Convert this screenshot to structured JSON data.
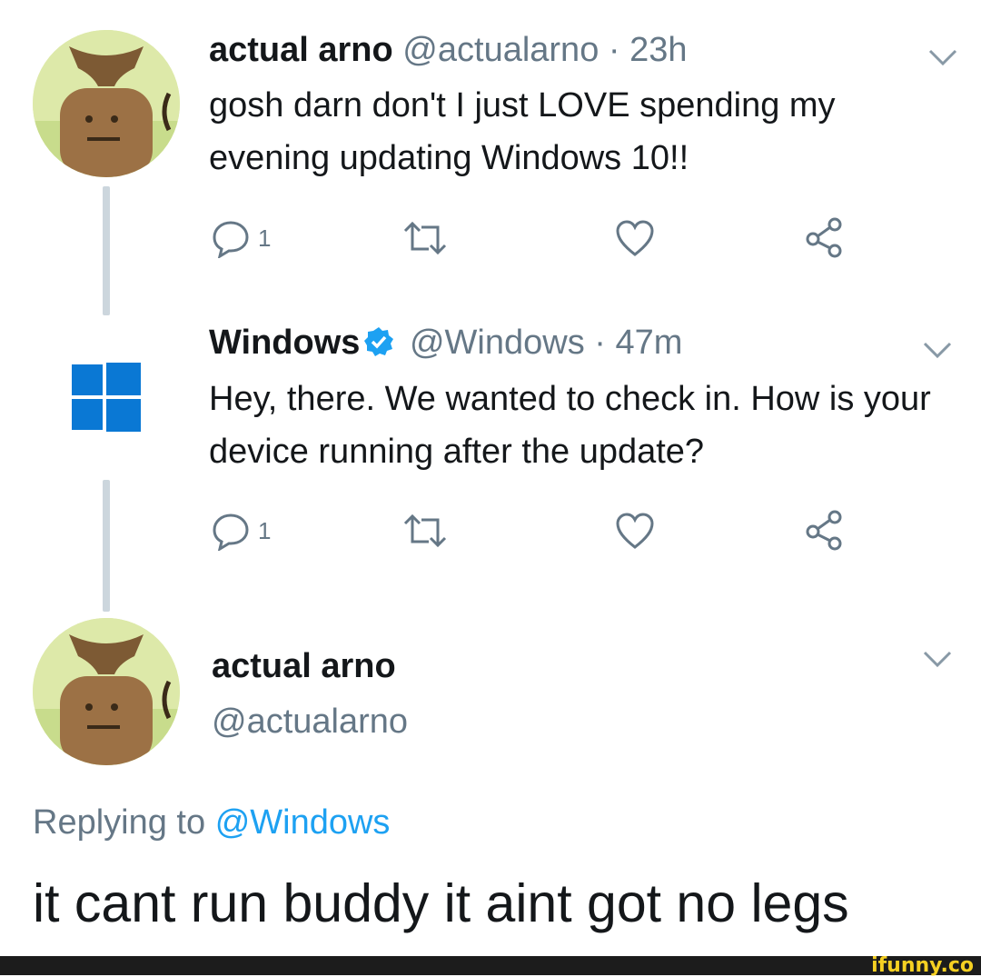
{
  "tweet1": {
    "name": "actual arno",
    "handle": "@actualarno",
    "separator": "·",
    "time": "23h",
    "text": "gosh darn don't I just LOVE spending my evening updating Windows 10!!",
    "reply_count": "1"
  },
  "tweet2": {
    "name": "Windows",
    "handle": "@Windows",
    "separator": "·",
    "time": "47m",
    "text": "Hey, there. We wanted to check in. How is your device running after the update?",
    "reply_count": "1"
  },
  "reply": {
    "name": "actual arno",
    "handle": "@actualarno",
    "replying_prefix": "Replying to",
    "replying_mention": "@Windows",
    "text": "it cant run buddy it aint got no legs"
  },
  "watermark": "ifunny.co",
  "colors": {
    "accent": "#1da1f2",
    "muted": "#657786",
    "thread_line": "#ccd6dd",
    "windows_blue": "#0a78d4",
    "text": "#14171a"
  },
  "icons": [
    "reply-icon",
    "retweet-icon",
    "like-icon",
    "share-icon",
    "chevron-down-icon",
    "verified-badge-icon",
    "windows-logo"
  ]
}
